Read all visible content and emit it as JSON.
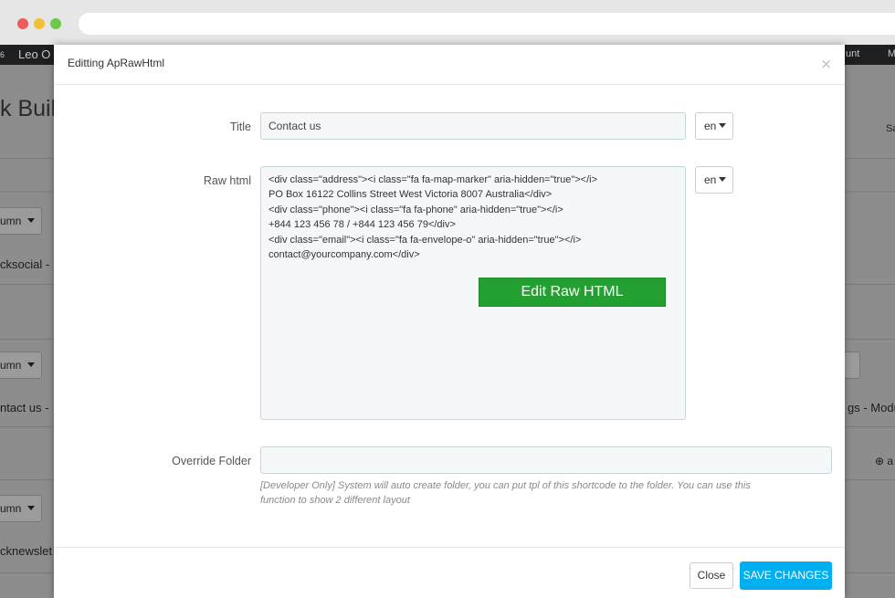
{
  "background": {
    "topbar_left_fragment": "6",
    "topbar_app_fragment": "Leo O",
    "topbar_right_fragment": "unt",
    "topbar_far_right_fragment": "M",
    "heading_fragment": "k Buil",
    "right_fragment_1": "Sa",
    "column_dropdown_1": "umn",
    "row_text_1": "cksocial -",
    "column_dropdown_2": "umn",
    "row_text_2": "ntact us -",
    "right_text_2": "gs - Modu",
    "column_dropdown_3": "umn",
    "row_text_3": "cknewslet",
    "add_fragment": "a"
  },
  "modal": {
    "title": "Editting ApRawHtml",
    "close_glyph": "×",
    "fields": {
      "title_label": "Title",
      "title_value": "Contact us",
      "title_lang": "en",
      "raw_html_label": "Raw html",
      "raw_html_lang": "en",
      "raw_html_lines": [
        "<div class=\"address\"><i class=\"fa fa-map-marker\" aria-hidden=\"true\"></i>",
        "PO Box 16122 Collins Street West Victoria 8007 Australia</div>",
        "<div class=\"phone\"><i class=\"fa fa-phone\" aria-hidden=\"true\"></i>",
        "+844 123 456 78 / +844 123 456 79</div>",
        "<div class=\"email\"><i class=\"fa fa-envelope-o\" aria-hidden=\"true\"></i>",
        "contact@yourcompany.com</div>"
      ],
      "edit_raw_html_button": "Edit Raw HTML",
      "override_folder_label": "Override Folder",
      "override_folder_value": "",
      "override_folder_help_1": "[Developer Only] System will auto create folder, you can put tpl of this shortcode to the folder. You can use this",
      "override_folder_help_2": "function to show 2 different layout"
    },
    "footer": {
      "close_label": "Close",
      "save_label": "SAVE CHANGES"
    }
  },
  "colors": {
    "save_button": "#00aff0",
    "edit_raw_button": "#24a032"
  }
}
